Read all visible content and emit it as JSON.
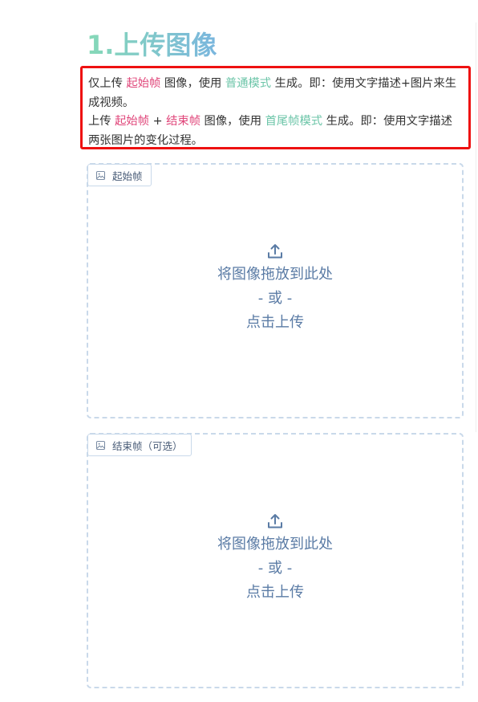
{
  "section": {
    "title": "1.上传图像"
  },
  "notice": {
    "line1": {
      "prefix": "仅上传 ",
      "start_frame": "起始帧",
      "mid": " 图像，使用 ",
      "mode": "普通模式",
      "suffix": " 生成。即：使用文字描述+图片来生成视频。"
    },
    "line2": {
      "prefix": "上传 ",
      "start_frame": "起始帧",
      "plus": " + ",
      "end_frame": "结束帧",
      "mid": " 图像，使用 ",
      "mode": "首尾帧模式",
      "suffix": " 生成。即：使用文字描述两张图片的变化过程。"
    }
  },
  "start_panel": {
    "label": "起始帧",
    "drop_text": "将图像拖放到此处",
    "or_text": "- 或 -",
    "click_text": "点击上传"
  },
  "end_panel": {
    "label": "结束帧（可选）",
    "drop_text": "将图像拖放到此处",
    "or_text": "- 或 -",
    "click_text": "点击上传"
  },
  "colors": {
    "highlight_red": "#e0467a",
    "highlight_green": "#6cc5a8",
    "notice_border": "#ee1111",
    "dashed_border": "#c9d9ea",
    "drop_text": "#5a7ba5"
  },
  "icons": {
    "panel_tag": "image-icon",
    "drop_zone": "upload-icon"
  }
}
